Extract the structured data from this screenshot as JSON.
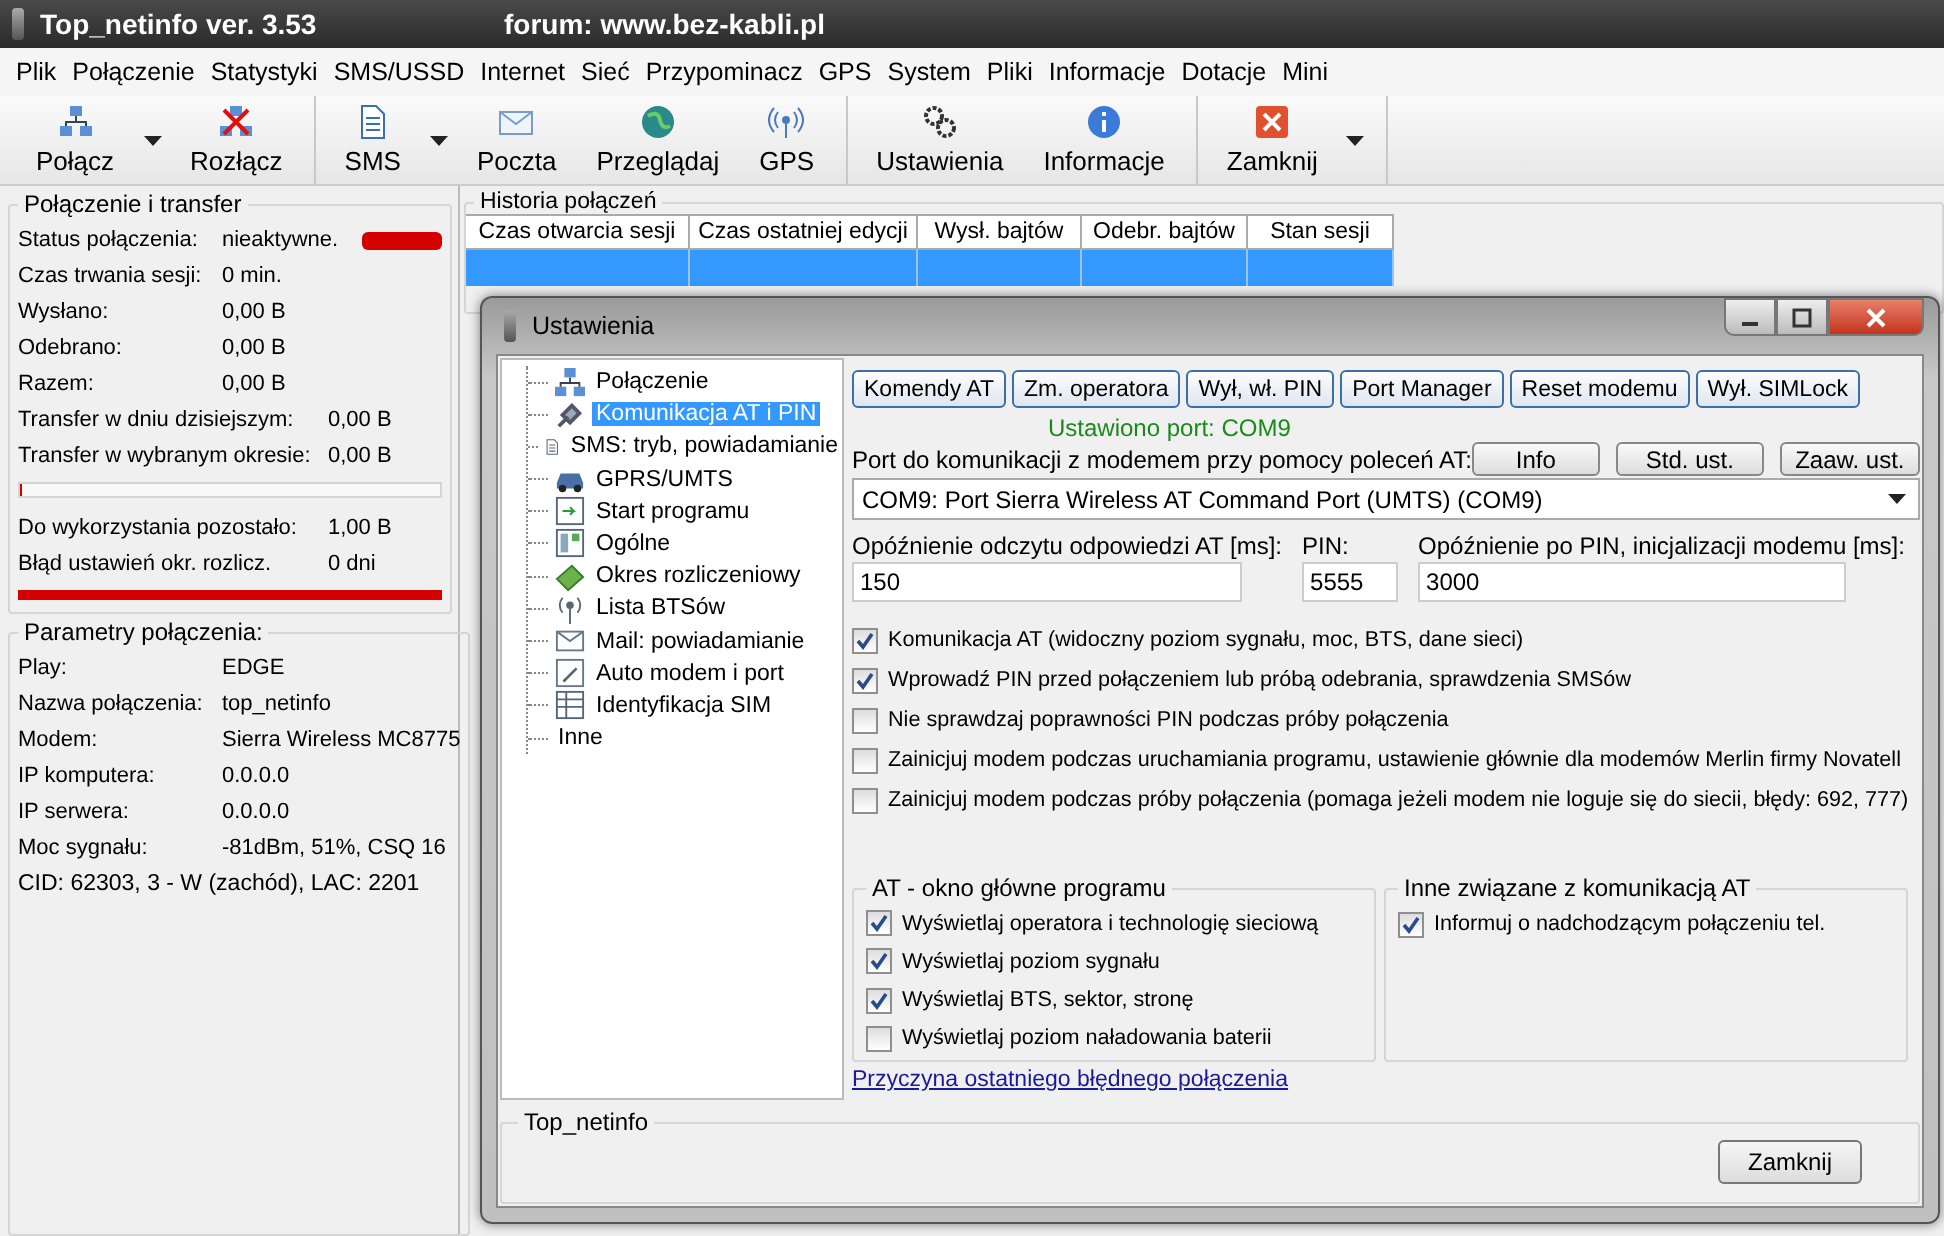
{
  "window": {
    "title": "Top_netinfo ver. 3.53",
    "subtitle": "forum: www.bez-kabli.pl"
  },
  "menu": [
    "Plik",
    "Połączenie",
    "Statystyki",
    "SMS/USSD",
    "Internet",
    "Sieć",
    "Przypominacz",
    "GPS",
    "System",
    "Pliki",
    "Informacje",
    "Dotacje",
    "Mini"
  ],
  "toolbar": {
    "groups": [
      {
        "buttons": [
          {
            "label": "Połącz",
            "dropdown": true
          },
          {
            "label": "Rozłącz",
            "dropdown": false
          }
        ]
      },
      {
        "buttons": [
          {
            "label": "SMS",
            "dropdown": true
          },
          {
            "label": "Poczta",
            "dropdown": false
          },
          {
            "label": "Przeglądaj",
            "dropdown": false
          },
          {
            "label": "GPS",
            "dropdown": false
          }
        ]
      },
      {
        "buttons": [
          {
            "label": "Ustawienia",
            "dropdown": false
          },
          {
            "label": "Informacje",
            "dropdown": false
          }
        ]
      },
      {
        "buttons": [
          {
            "label": "Zamknij",
            "dropdown": true
          }
        ]
      }
    ]
  },
  "connection_transfer": {
    "title": "Połączenie i transfer",
    "status": {
      "label": "Status połączenia:",
      "value": "nieaktywne.",
      "connected": false
    },
    "rows": [
      {
        "label": "Czas trwania sesji:",
        "value": "0 min."
      },
      {
        "label": "Wysłano:",
        "value": "0,00 B"
      },
      {
        "label": "Odebrano:",
        "value": "0,00 B"
      },
      {
        "label": "Razem:",
        "value": "0,00 B"
      }
    ],
    "transfer_rows": [
      {
        "label": "Transfer w dniu dzisiejszym:",
        "value": "0,00 B"
      },
      {
        "label": "Transfer w wybranym okresie:",
        "value": "0,00 B"
      }
    ],
    "transfer_bar": {
      "level": 0
    },
    "quota_rows": [
      {
        "label": "Do wykorzystania pozostało:",
        "value": "1,00 B"
      },
      {
        "label": "Błąd ustawień okr. rozlicz.",
        "value": "0 dni"
      }
    ],
    "period_bar": {
      "level": 1
    }
  },
  "connection_params": {
    "title": "Parametry połączenia:",
    "rows": [
      {
        "label": "Play:",
        "value": "EDGE"
      },
      {
        "label": "Nazwa połączenia:",
        "value": "top_netinfo"
      },
      {
        "label": "Modem:",
        "value": "Sierra Wireless MC8775"
      },
      {
        "label": "IP komputera:",
        "value": "0.0.0.0"
      },
      {
        "label": "IP serwera:",
        "value": "0.0.0.0"
      },
      {
        "label": "Moc sygnału:",
        "value": "-81dBm, 51%, CSQ 16"
      }
    ],
    "cell_info": "CID: 62303, 3 - W (zachód), LAC: 2201"
  },
  "history": {
    "title": "Historia połączeń",
    "columns": [
      "Czas otwarcia sesji",
      "Czas ostatniej edycji",
      "Wysł. bajtów",
      "Odebr. bajtów",
      "Stan sesji"
    ],
    "rows": [
      {
        "selected": true
      }
    ]
  },
  "settings_dialog": {
    "title": "Ustawienia",
    "tree": [
      {
        "label": "Połączenie",
        "selected": false
      },
      {
        "label": "Komunikacja AT i PIN",
        "selected": true
      },
      {
        "label": "SMS: tryb, powiadamianie",
        "selected": false
      },
      {
        "label": "GPRS/UMTS",
        "selected": false
      },
      {
        "label": "Start programu",
        "selected": false
      },
      {
        "label": "Ogólne",
        "selected": false
      },
      {
        "label": "Okres rozliczeniowy",
        "selected": false
      },
      {
        "label": "Lista BTSów",
        "selected": false
      },
      {
        "label": "Mail: powiadamianie",
        "selected": false
      },
      {
        "label": "Auto modem i port",
        "selected": false
      },
      {
        "label": "Identyfikacja SIM",
        "selected": false
      },
      {
        "label": "Inne",
        "selected": false
      }
    ],
    "tool_buttons": [
      "Komendy AT",
      "Zm. operatora",
      "Wył, wł. PIN",
      "Port Manager",
      "Reset modemu",
      "Wył. SIMLock"
    ],
    "port_status": "Ustawiono port: COM9",
    "port_label": "Port do komunikacji z modemem przy pomocy poleceń AT:",
    "port_buttons": [
      "Info",
      "Std. ust.",
      "Zaaw. ust."
    ],
    "port_value": "COM9: Port Sierra Wireless AT Command Port (UMTS) (COM9)",
    "fields": [
      {
        "label": "Opóźnienie odczytu odpowiedzi AT [ms]:",
        "value": "150"
      },
      {
        "label": "PIN:",
        "value": "5555"
      },
      {
        "label": "Opóźnienie po PIN, inicjalizacji modemu [ms]:",
        "value": "3000"
      }
    ],
    "options": [
      {
        "label": "Komunikacja AT (widoczny poziom sygnału, moc, BTS, dane sieci)",
        "checked": true
      },
      {
        "label": "Wprowadź PIN przed połączeniem lub próbą odebrania, sprawdzenia SMSów",
        "checked": true
      },
      {
        "label": "Nie sprawdzaj poprawności PIN podczas próby połączenia",
        "checked": false
      },
      {
        "label": "Zainicjuj modem podczas uruchamiania programu, ustawienie głównie dla modemów Merlin firmy Novatell",
        "checked": false
      },
      {
        "label": "Zainicjuj modem podczas próby połączenia (pomaga jeżeli modem nie loguje się do siecii, błędy: 692, 777)",
        "checked": false
      }
    ],
    "groups": [
      {
        "title": "AT - okno główne programu",
        "options": [
          {
            "label": "Wyświetlaj operatora i technologię sieciową",
            "checked": true
          },
          {
            "label": "Wyświetlaj poziom sygnału",
            "checked": true
          },
          {
            "label": "Wyświetlaj BTS, sektor, stronę",
            "checked": true
          },
          {
            "label": "Wyświetlaj poziom naładowania baterii",
            "checked": false
          }
        ]
      },
      {
        "title": "Inne związane z komunikacją AT",
        "options": [
          {
            "label": "Informuj o nadchodzącym połączeniu tel.",
            "checked": true
          }
        ]
      }
    ],
    "link": "Przyczyna ostatniego błędnego połączenia",
    "footer": {
      "title": "Top_netinfo",
      "button": "Zamknij"
    }
  }
}
